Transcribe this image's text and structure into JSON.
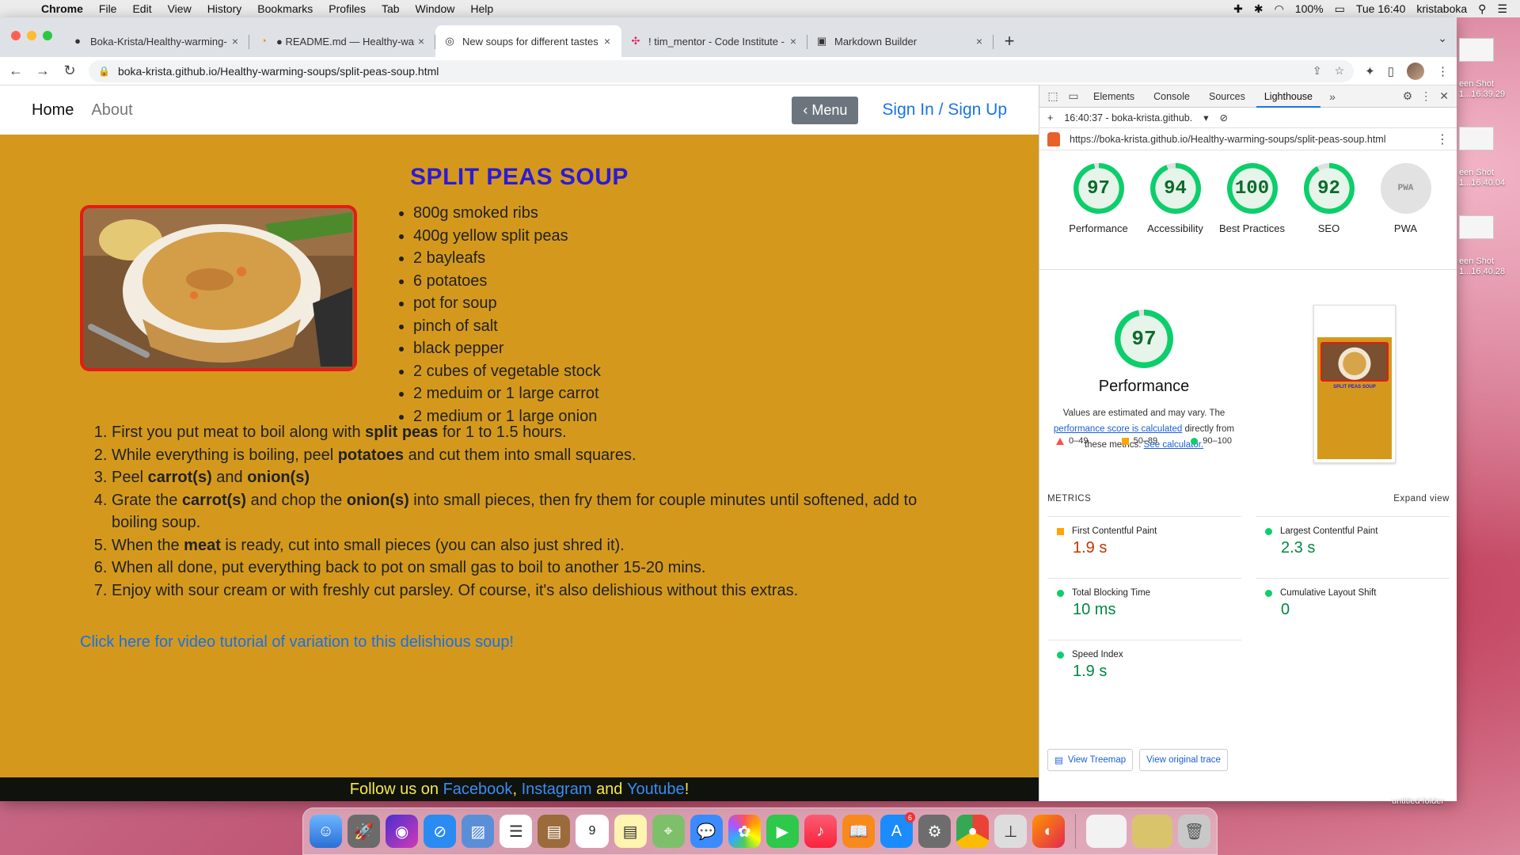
{
  "menubar": {
    "app": "Chrome",
    "items": [
      "File",
      "Edit",
      "View",
      "History",
      "Bookmarks",
      "Profiles",
      "Tab",
      "Window",
      "Help"
    ],
    "battery": "100%",
    "clock": "Tue 16:40",
    "user": "kristaboka"
  },
  "browser": {
    "tabs": [
      {
        "label": "Boka-Krista/Healthy-warming-",
        "icon": "github-icon"
      },
      {
        "label": "● README.md — Healthy-war",
        "icon": "gitpod-icon"
      },
      {
        "label": "New soups for different tastes",
        "icon": "globe-icon"
      },
      {
        "label": "! tim_mentor - Code Institute -",
        "icon": "slack-icon"
      },
      {
        "label": "Markdown Builder",
        "icon": "markdown-icon"
      }
    ],
    "url": "boka-krista.github.io/Healthy-warming-soups/split-peas-soup.html"
  },
  "site": {
    "nav": {
      "home": "Home",
      "about": "About",
      "menu": "‹ Menu",
      "signin": "Sign In / Sign Up"
    },
    "title": "SPLIT PEAS SOUP",
    "ingredients": [
      "800g smoked ribs",
      "400g yellow split peas",
      "2 bayleafs",
      "6 potatoes",
      "pot for soup",
      "pinch of salt",
      "black pepper",
      "2 cubes of vegetable stock",
      "2 meduim or 1 large carrot",
      "2 medium or 1 large onion"
    ],
    "steps": [
      {
        "a": "First you put meat to boil along with ",
        "b": "split peas",
        "c": " for 1 to 1.5 hours.",
        "d": "",
        "e": ""
      },
      {
        "a": "While everything is boiling, peel ",
        "b": "potatoes",
        "c": " and cut them into small squares.",
        "d": "",
        "e": ""
      },
      {
        "a": "Peel ",
        "b": "carrot(s)",
        "c": " and ",
        "d": "onion(s)",
        "e": ""
      },
      {
        "a": "Grate the ",
        "b": "carrot(s)",
        "c": " and chop the ",
        "d": "onion(s)",
        "e": " into small pieces, then fry them for couple minutes until softened, add to boiling soup."
      },
      {
        "a": "When the ",
        "b": "meat",
        "c": " is ready, cut into small pieces (you can also just shred it).",
        "d": "",
        "e": ""
      },
      {
        "a": "When all done, put everything back to pot on small gas to boil to another 15-20 mins.",
        "b": "",
        "c": "",
        "d": "",
        "e": ""
      },
      {
        "a": "Enjoy with sour cream or with freshly cut parsley. Of course, it's also delishious without this extras.",
        "b": "",
        "c": "",
        "d": "",
        "e": ""
      }
    ],
    "video_link": "Click here for video tutorial of variation to this delishious soup!",
    "footer": {
      "prefix": "Follow us on ",
      "facebook": "Facebook",
      "comma": ", ",
      "instagram": "Instagram",
      "and": " and ",
      "youtube": "Youtube",
      "suffix": "!"
    }
  },
  "devtools": {
    "tabs": [
      "Elements",
      "Console",
      "Sources",
      "Lighthouse"
    ],
    "active_tab": "Lighthouse",
    "report_label": "16:40:37 - boka-krista.github.",
    "report_url": "https://boka-krista.github.io/Healthy-warming-soups/split-peas-soup.html",
    "scores": [
      {
        "label": "Performance",
        "value": "97",
        "pct": 97
      },
      {
        "label": "Accessibility",
        "value": "94",
        "pct": 94
      },
      {
        "label": "Best Practices",
        "value": "100",
        "pct": 100
      },
      {
        "label": "SEO",
        "value": "92",
        "pct": 92
      },
      {
        "label": "PWA",
        "value": "PWA",
        "pct": 0
      }
    ],
    "perf": {
      "score": "97",
      "title": "Performance",
      "desc1": "Values are estimated and may vary. The ",
      "desc_link1": "performance score is calculated",
      "desc2": " directly from these metrics. ",
      "desc_link2": "See calculator."
    },
    "legend": [
      "0–49",
      "50–89",
      "90–100"
    ],
    "metrics_title": "METRICS",
    "expand": "Expand view",
    "metrics": [
      {
        "name": "First Contentful Paint",
        "value": "1.9 s",
        "status": "orange"
      },
      {
        "name": "Largest Contentful Paint",
        "value": "2.3 s",
        "status": "green"
      },
      {
        "name": "Total Blocking Time",
        "value": "10 ms",
        "status": "green"
      },
      {
        "name": "Cumulative Layout Shift",
        "value": "0",
        "status": "green"
      },
      {
        "name": "Speed Index",
        "value": "1.9 s",
        "status": "green"
      }
    ],
    "buttons": {
      "treemap": "View Treemap",
      "trace": "View original trace"
    },
    "thumb": {
      "title": "SPLIT PEAS SOUP"
    }
  },
  "desktop": {
    "shots": [
      {
        "l1": "een Shot",
        "l2": "1...16.39.29"
      },
      {
        "l1": "een Shot",
        "l2": "1...16.40.04"
      },
      {
        "l1": "een Shot",
        "l2": "1...16.40.28"
      }
    ],
    "folder": "untitled folder"
  },
  "colors": {
    "accent": "#1a73e8",
    "page_bg": "#d4991c",
    "title": "#2d1ad6",
    "pass": "#0cce6b",
    "average": "#ffa400",
    "fail": "#ff4e42"
  }
}
